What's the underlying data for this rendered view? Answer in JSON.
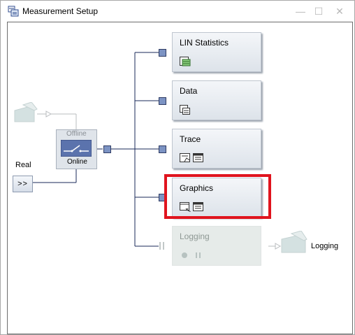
{
  "window": {
    "title": "Measurement Setup",
    "minimize_glyph": "—",
    "maximize_glyph": "☐",
    "close_glyph": "✕"
  },
  "source": {
    "label": "Real",
    "button_glyph": ">>"
  },
  "switch": {
    "offline_label": "Offline",
    "online_label": "Online"
  },
  "blocks": [
    {
      "title": "LIN Statistics",
      "icons": [
        "statistics-icon"
      ]
    },
    {
      "title": "Data",
      "icons": [
        "data-window-icon"
      ]
    },
    {
      "title": "Trace",
      "icons": [
        "trace-window-icon",
        "logfile-icon"
      ]
    },
    {
      "title": "Graphics",
      "icons": [
        "graphics-window-icon",
        "logfile-icon"
      ]
    },
    {
      "title": "Logging",
      "icons": [
        "record-dot-icon",
        "pause-icon"
      ],
      "state": "disabled"
    }
  ],
  "logging_output": {
    "label": "Logging"
  },
  "highlight": {
    "target": "Graphics",
    "color": "#e0141e"
  }
}
